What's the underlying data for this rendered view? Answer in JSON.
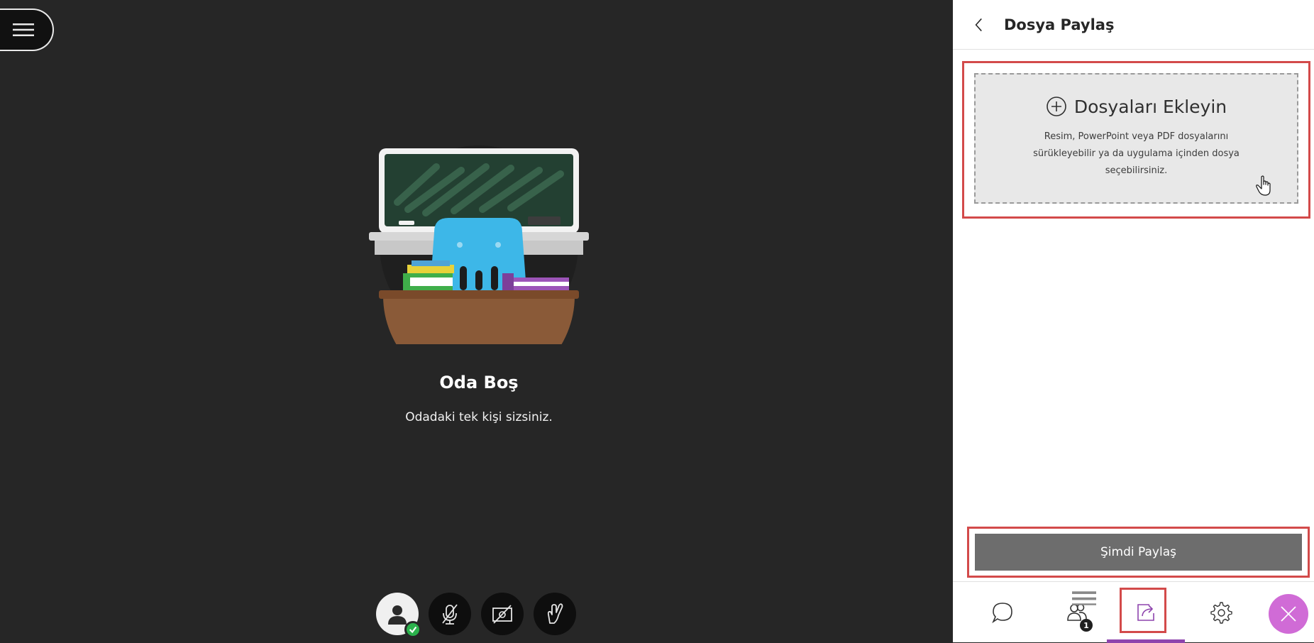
{
  "stage": {
    "menu_icon": "hamburger-icon",
    "room_title": "Oda Boş",
    "room_subtitle": "Odadaki tek kişi sizsiniz.",
    "controls": [
      {
        "name": "avatar",
        "icon": "user-avatar-icon",
        "status": "check-icon"
      },
      {
        "name": "microphone",
        "icon": "microphone-off-icon"
      },
      {
        "name": "camera",
        "icon": "camera-off-icon"
      },
      {
        "name": "hand",
        "icon": "raise-hand-icon"
      }
    ]
  },
  "panel": {
    "back_icon": "chevron-left-icon",
    "title": "Dosya Paylaş",
    "dropzone": {
      "title": "Dosyaları Ekleyin",
      "icon": "plus-circle-icon",
      "description": "Resim, PowerPoint veya PDF dosyalarını sürükleyebilir ya da uygulama içinden dosya seçebilirsiniz."
    },
    "share_button": "Şimdi Paylaş",
    "tabs": [
      {
        "name": "chat",
        "icon": "chat-bubble-icon"
      },
      {
        "name": "participants",
        "icon": "people-icon",
        "badge": "1"
      },
      {
        "name": "share-content",
        "icon": "share-icon",
        "active": true
      },
      {
        "name": "settings",
        "icon": "gear-icon"
      },
      {
        "name": "close",
        "icon": "close-icon"
      }
    ]
  },
  "colors": {
    "stage_bg": "#262626",
    "panel_bg": "#ffffff",
    "highlight": "#d34a4a",
    "share_button_bg": "#6d6d6d",
    "active_tab_accent": "#8e44ad",
    "close_button_bg": "#d06bd6",
    "status_green": "#2bb24c"
  }
}
